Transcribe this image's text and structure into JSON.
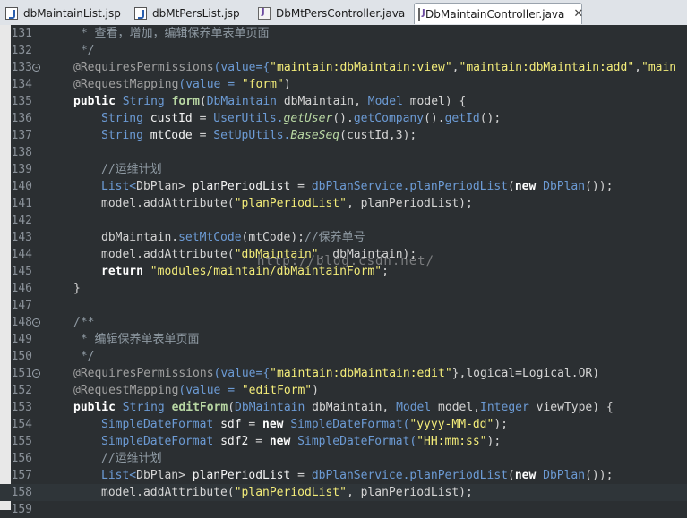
{
  "tabs": [
    {
      "label": "dbMaintainList.jsp",
      "icon": "jsp-file-icon",
      "active": false
    },
    {
      "label": "dbMtPersList.jsp",
      "icon": "jsp-file-icon",
      "active": false
    },
    {
      "label": "DbMtPersController.java",
      "icon": "java-file-icon",
      "active": false
    },
    {
      "label": "DbMaintainController.java",
      "icon": "java-file-icon",
      "active": true,
      "close": "✕"
    }
  ],
  "lines": [
    {
      "num": "131"
    },
    {
      "num": "132"
    },
    {
      "num": "133"
    },
    {
      "num": "134"
    },
    {
      "num": "135"
    },
    {
      "num": "136"
    },
    {
      "num": "137"
    },
    {
      "num": "138"
    },
    {
      "num": "139"
    },
    {
      "num": "140"
    },
    {
      "num": "141"
    },
    {
      "num": "142"
    },
    {
      "num": "143"
    },
    {
      "num": "144"
    },
    {
      "num": "145"
    },
    {
      "num": "146"
    },
    {
      "num": "147"
    },
    {
      "num": "148"
    },
    {
      "num": "149"
    },
    {
      "num": "150"
    },
    {
      "num": "151"
    },
    {
      "num": "152"
    },
    {
      "num": "153"
    },
    {
      "num": "154"
    },
    {
      "num": "155"
    },
    {
      "num": "156"
    },
    {
      "num": "157"
    },
    {
      "num": "158"
    },
    {
      "num": "159"
    }
  ],
  "code": {
    "l131": " * 查看，增加，编辑保养单表单页面",
    "l132": " */",
    "l133a": "@RequiresPermissions",
    "l133b": "(value={",
    "l133c": "\"maintain:dbMaintain:view\"",
    "l133d": ",",
    "l133e": "\"maintain:dbMaintain:add\"",
    "l133f": ",",
    "l133g": "\"main",
    "l134a": "@RequestMapping",
    "l134b": "(value = ",
    "l134c": "\"form\"",
    "l134d": ")",
    "l135a": "public",
    "l135b": " String ",
    "l135c": "form",
    "l135d": "(",
    "l135e": "DbMaintain",
    "l135f": " dbMaintain, ",
    "l135g": "Model",
    "l135h": " model) {",
    "l136a": "String ",
    "l136b": "custId",
    "l136c": " = ",
    "l136d": "UserUtils.",
    "l136e": "getUser",
    "l136f": "().",
    "l136g": "getCompany",
    "l136h": "().",
    "l136i": "getId",
    "l136j": "();",
    "l137a": "String ",
    "l137b": "mtCode",
    "l137c": " = ",
    "l137d": "SetUpUtils.",
    "l137e": "BaseSeq",
    "l137f": "(custId,3);",
    "l139": "//运维计划",
    "l140a": "List<",
    "l140b": "DbPlan",
    "l140c": "> ",
    "l140d": "planPeriodList",
    "l140e": " = ",
    "l140f": "dbPlanService.",
    "l140g": "planPeriodList",
    "l140h": "(",
    "l140i": "new",
    "l140j": " DbPlan",
    "l140k": "());",
    "l141a": "model.addAttribute(",
    "l141b": "\"planPeriodList\"",
    "l141c": ", planPeriodList);",
    "l143a": "dbMaintain.",
    "l143b": "setMtCode",
    "l143c": "(mtCode);",
    "l143d": "//保养单号",
    "l144a": "model.addAttribute(",
    "l144b": "\"dbMaintain\"",
    "l144c": ", dbMaintain);",
    "l145a": "return",
    "l145b": " \"modules/maintain/dbMaintainForm\"",
    "l145c": ";",
    "l146": "}",
    "l148": "/**",
    "l149": " * 编辑保养单表单页面",
    "l150": " */",
    "l151a": "@RequiresPermissions",
    "l151b": "(value={",
    "l151c": "\"maintain:dbMaintain:edit\"",
    "l151d": "},logical=Logical.",
    "l151e": "OR",
    "l151f": ")",
    "l152a": "@RequestMapping",
    "l152b": "(value = ",
    "l152c": "\"editForm\"",
    "l152d": ")",
    "l153a": "public",
    "l153b": " String ",
    "l153c": "editForm",
    "l153d": "(",
    "l153e": "DbMaintain",
    "l153f": " dbMaintain, ",
    "l153g": "Model",
    "l153h": " model,",
    "l153i": "Integer",
    "l153j": " viewType) {",
    "l154a": "SimpleDateFormat ",
    "l154b": "sdf",
    "l154c": " = ",
    "l154d": "new",
    "l154e": " SimpleDateFormat(",
    "l154f": "\"yyyy-MM-dd\"",
    "l154g": ");",
    "l155a": "SimpleDateFormat ",
    "l155b": "sdf2",
    "l155c": " = ",
    "l155d": "new",
    "l155e": " SimpleDateFormat(",
    "l155f": "\"HH:mm:ss\"",
    "l155g": ");",
    "l156": "//运维计划",
    "l157a": "List<",
    "l157b": "DbPlan",
    "l157c": "> ",
    "l157d": "planPeriodList",
    "l157e": " = ",
    "l157f": "dbPlanService.",
    "l157g": "planPeriodList",
    "l157h": "(",
    "l157i": "new",
    "l157j": " DbPlan",
    "l157k": "());",
    "l158a": "model.addAttribute(",
    "l158b": "\"planPeriodList\"",
    "l158c": ", planPeriodList);"
  },
  "watermark": "http://blog.csdn.net/",
  "colors": {
    "string": "#f3ec79",
    "type": "#6c9bd5",
    "comment": "#8f9aa3",
    "background": "#2b2f32"
  }
}
